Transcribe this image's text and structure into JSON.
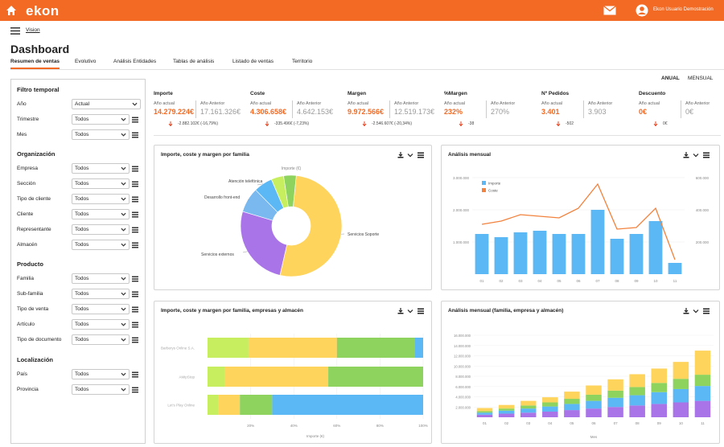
{
  "app": {
    "logo": "ekon",
    "user_name": "Ekon Usuario Demostración"
  },
  "colors": {
    "brand": "#f26a24",
    "bar_blue": "#5bb8f5",
    "line_orange": "#f2823d",
    "yellow": "#ffd45c",
    "green": "#8dd35e",
    "purple": "#a874e8",
    "lime": "#c7ee5e",
    "light_blue": "#7ab8f0"
  },
  "icons": {
    "home": "home-icon",
    "mail": "mail-icon",
    "user": "user-circle-icon",
    "menu": "hamburger-menu-icon"
  },
  "breadcrumb": "Vision",
  "page_title": "Dashboard",
  "tabs": [
    "Resumen de ventas",
    "Evolutivo",
    "Análisis Entidades",
    "Tablas de análisis",
    "Listado de ventas",
    "Territorio"
  ],
  "active_tab": "Resumen de ventas",
  "period": {
    "annual": "ANUAL",
    "monthly": "MENSUAL",
    "selected": "ANUAL"
  },
  "filters": {
    "temporal": {
      "title": "Filtro temporal",
      "items": [
        {
          "label": "Año",
          "value": "Actual"
        },
        {
          "label": "Trimestre",
          "value": "Todos"
        },
        {
          "label": "Mes",
          "value": "Todos"
        }
      ]
    },
    "organizacion": {
      "title": "Organización",
      "items": [
        {
          "label": "Empresa",
          "value": "Todos"
        },
        {
          "label": "Sección",
          "value": "Todos"
        },
        {
          "label": "Tipo de cliente",
          "value": "Todos"
        },
        {
          "label": "Cliente",
          "value": "Todos"
        },
        {
          "label": "Representante",
          "value": "Todos"
        },
        {
          "label": "Almacén",
          "value": "Todos"
        }
      ]
    },
    "producto": {
      "title": "Producto",
      "items": [
        {
          "label": "Familia",
          "value": "Todos"
        },
        {
          "label": "Sub-familia",
          "value": "Todos"
        },
        {
          "label": "Tipo de venta",
          "value": "Todos"
        },
        {
          "label": "Artículo",
          "value": "Todos"
        },
        {
          "label": "Tipo de documento",
          "value": "Todos"
        }
      ]
    },
    "localizacion": {
      "title": "Localización",
      "items": [
        {
          "label": "País",
          "value": "Todos"
        },
        {
          "label": "Provincia",
          "value": "Todos"
        }
      ]
    }
  },
  "kpis": [
    {
      "title": "Importe",
      "current_label": "Año actual",
      "previous_label": "Año Anterior",
      "current": "14.279.224€",
      "previous": "17.161.326€",
      "diff": "-2.882.102€ (-16,79%)"
    },
    {
      "title": "Coste",
      "current_label": "Año actual",
      "previous_label": "Año Anterior",
      "current": "4.306.658€",
      "previous": "4.642.153€",
      "diff": "-335.496€ (-7,23%)"
    },
    {
      "title": "Margen",
      "current_label": "Año actual",
      "previous_label": "Año Anterior",
      "current": "9.972.566€",
      "previous": "12.519.173€",
      "diff": "-2.546.607€ (-20,34%)"
    },
    {
      "title": "%Margen",
      "current_label": "Año actual",
      "previous_label": "Año Anterior",
      "current": "232%",
      "previous": "270%",
      "diff": "-38"
    },
    {
      "title": "Nº Pedidos",
      "current_label": "Año actual",
      "previous_label": "Año Anterior",
      "current": "3.401",
      "previous": "3.903",
      "diff": "-502"
    },
    {
      "title": "Descuento",
      "current_label": "Año actual",
      "previous_label": "Año Anterior",
      "current": "0€",
      "previous": "0€",
      "diff": "0€"
    }
  ],
  "cards": {
    "pie": {
      "title": "Importe, coste y margen por familia",
      "top_label": "Importe (€)"
    },
    "monthly": {
      "title": "Análisis mensual"
    },
    "hbar": {
      "title": "Importe, coste y margen por familia, empresas y almacén"
    },
    "stacked": {
      "title": "Análisis mensual (familia, empresa y almacén)"
    }
  },
  "chart_data": [
    {
      "type": "pie",
      "title": "Importe, coste y margen por familia",
      "subtitle": "Importe (€)",
      "donut": true,
      "slices": [
        {
          "label": "Servicios Soporte",
          "value": 52,
          "color": "#ffd45c"
        },
        {
          "label": "Servicios externos",
          "value": 26,
          "color": "#a874e8"
        },
        {
          "label": "Desarrollo front-end",
          "value": 8,
          "color": "#7ab8f0"
        },
        {
          "label": "Atención telefónica",
          "value": 6,
          "color": "#5bb8f5"
        },
        {
          "label": "",
          "value": 4,
          "color": "#c7ee5e"
        },
        {
          "label": "",
          "value": 4,
          "color": "#8dd35e"
        }
      ]
    },
    {
      "type": "bar",
      "title": "Análisis mensual",
      "categories": [
        "01",
        "02",
        "03",
        "04",
        "05",
        "06",
        "07",
        "08",
        "09",
        "10",
        "11"
      ],
      "series": [
        {
          "name": "Importe",
          "type": "bar",
          "axis": "left",
          "values": [
            1250000,
            1150000,
            1300000,
            1350000,
            1250000,
            1250000,
            2000000,
            1100000,
            1250000,
            1650000,
            350000
          ]
        },
        {
          "name": "Coste",
          "type": "line",
          "axis": "right",
          "values": [
            310000,
            330000,
            370000,
            360000,
            350000,
            410000,
            560000,
            280000,
            290000,
            410000,
            90000
          ]
        }
      ],
      "ylim": [
        0,
        3000000
      ],
      "y2lim": [
        0,
        600000
      ],
      "y_ticks": [
        "1.000.000",
        "2.000.000",
        "3.000.000"
      ],
      "y2_ticks": [
        "200.000",
        "400.000",
        "600.000"
      ],
      "legend": "top-left"
    },
    {
      "type": "bar",
      "orientation": "horizontal",
      "stacked": true,
      "percent": true,
      "title": "Importe, coste y margen por familia, empresas y almacén",
      "categories": [
        "Barberys Online S.A.",
        "AMipStop",
        "Let's Play Online"
      ],
      "series": [
        {
          "name": "",
          "color": "#c7ee5e",
          "values": [
            19,
            8,
            5
          ]
        },
        {
          "name": "",
          "color": "#ffd45c",
          "values": [
            41,
            48,
            10
          ]
        },
        {
          "name": "",
          "color": "#8dd35e",
          "values": [
            36,
            44,
            15
          ]
        },
        {
          "name": "",
          "color": "#5bb8f5",
          "values": [
            4,
            0,
            70
          ]
        }
      ],
      "x_ticks": [
        "20%",
        "40%",
        "60%",
        "80%",
        "100%"
      ],
      "xlabel": "Importe (€)"
    },
    {
      "type": "bar",
      "stacked": true,
      "title": "Análisis mensual (familia, empresa y almacén)",
      "categories": [
        "01",
        "02",
        "03",
        "04",
        "05",
        "06",
        "07",
        "08",
        "09",
        "10",
        "11"
      ],
      "series": [
        {
          "name": "",
          "color": "#a874e8",
          "values": [
            500000,
            700000,
            900000,
            1100000,
            1400000,
            1700000,
            2000000,
            2300000,
            2600000,
            2900000,
            3200000
          ]
        },
        {
          "name": "",
          "color": "#5bb8f5",
          "values": [
            400000,
            600000,
            800000,
            1000000,
            1200000,
            1500000,
            1800000,
            2000000,
            2300000,
            2600000,
            2900000
          ]
        },
        {
          "name": "",
          "color": "#8dd35e",
          "values": [
            300000,
            400000,
            600000,
            800000,
            1000000,
            1200000,
            1400000,
            1600000,
            1800000,
            2000000,
            2200000
          ]
        },
        {
          "name": "",
          "color": "#ffd45c",
          "values": [
            600000,
            700000,
            900000,
            1000000,
            1400000,
            1800000,
            2200000,
            2500000,
            2800000,
            3300000,
            4700000
          ]
        }
      ],
      "ylim": [
        0,
        16000000
      ],
      "y_ticks": [
        "2.000.000",
        "4.000.000",
        "6.000.000",
        "8.000.000",
        "10.000.000",
        "12.000.000",
        "14.000.000",
        "16.000.000"
      ],
      "xlabel": "Mes"
    }
  ]
}
